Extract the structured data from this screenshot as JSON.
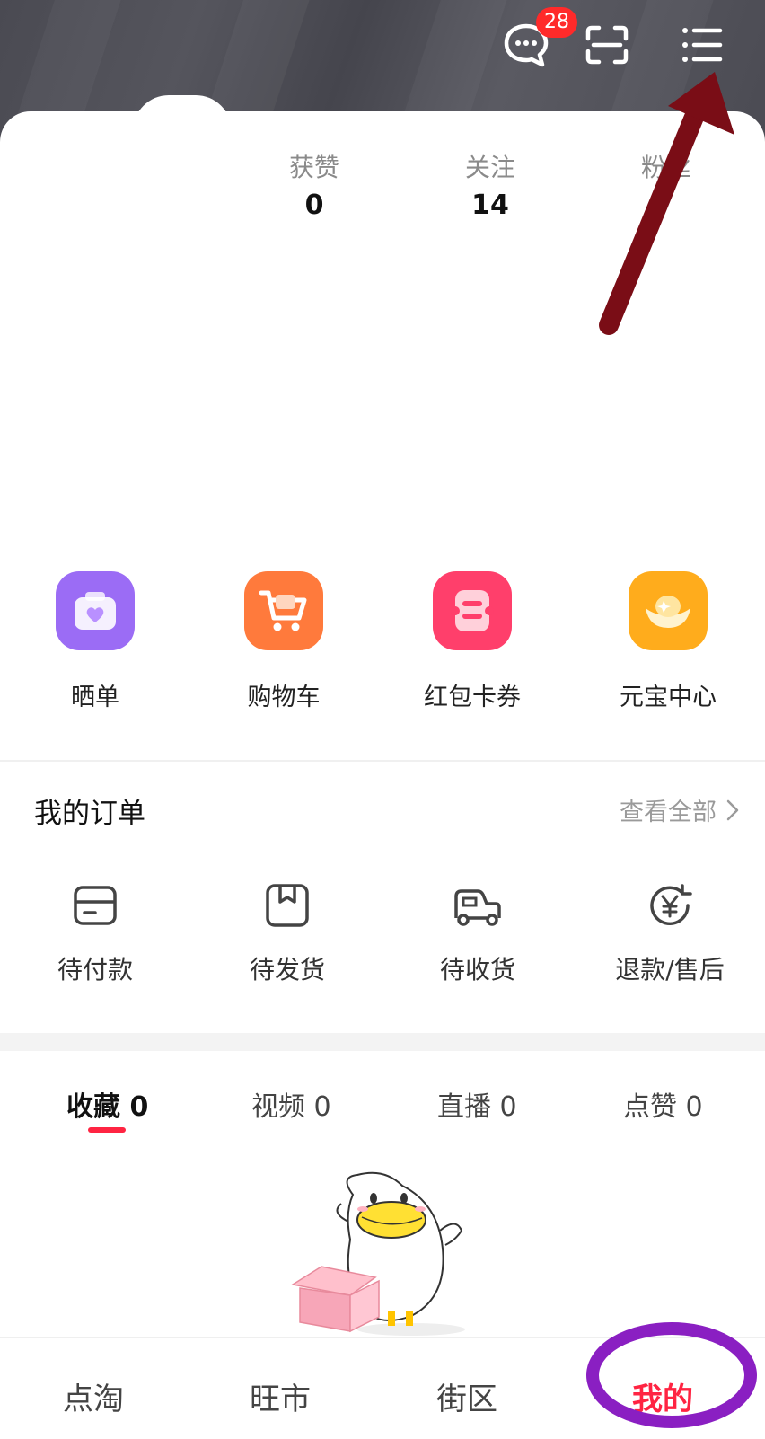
{
  "header": {
    "message_badge": "28",
    "icons": [
      "message-icon",
      "scan-icon",
      "menu-icon"
    ]
  },
  "stats": [
    {
      "label": "获赞",
      "value": "0"
    },
    {
      "label": "关注",
      "value": "14"
    },
    {
      "label": "粉丝",
      "value": ""
    }
  ],
  "quick_actions": [
    {
      "label": "晒单",
      "icon": "share-order-icon",
      "color": "#9b6cf5"
    },
    {
      "label": "购物车",
      "icon": "cart-icon",
      "color": "#ff7a3c"
    },
    {
      "label": "红包卡券",
      "icon": "coupon-icon",
      "color": "#ff3f6b"
    },
    {
      "label": "元宝中心",
      "icon": "ingot-icon",
      "color": "#ffac1c"
    }
  ],
  "orders": {
    "title": "我的订单",
    "view_all": "查看全部",
    "items": [
      {
        "label": "待付款",
        "icon": "wallet-icon"
      },
      {
        "label": "待发货",
        "icon": "package-icon"
      },
      {
        "label": "待收货",
        "icon": "truck-icon"
      },
      {
        "label": "退款/售后",
        "icon": "refund-icon"
      }
    ]
  },
  "content_tabs": [
    {
      "label": "收藏 0",
      "active": true
    },
    {
      "label": "视频 0",
      "active": false
    },
    {
      "label": "直播 0",
      "active": false
    },
    {
      "label": "点赞 0",
      "active": false
    }
  ],
  "bottom_nav": [
    {
      "label": "点淘",
      "active": false
    },
    {
      "label": "旺市",
      "active": false
    },
    {
      "label": "街区",
      "active": false
    },
    {
      "label": "我的",
      "active": true
    }
  ],
  "colors": {
    "accent": "#ff2442",
    "annotation_arrow": "#7a0d16",
    "annotation_circle": "#8a1fc2"
  }
}
